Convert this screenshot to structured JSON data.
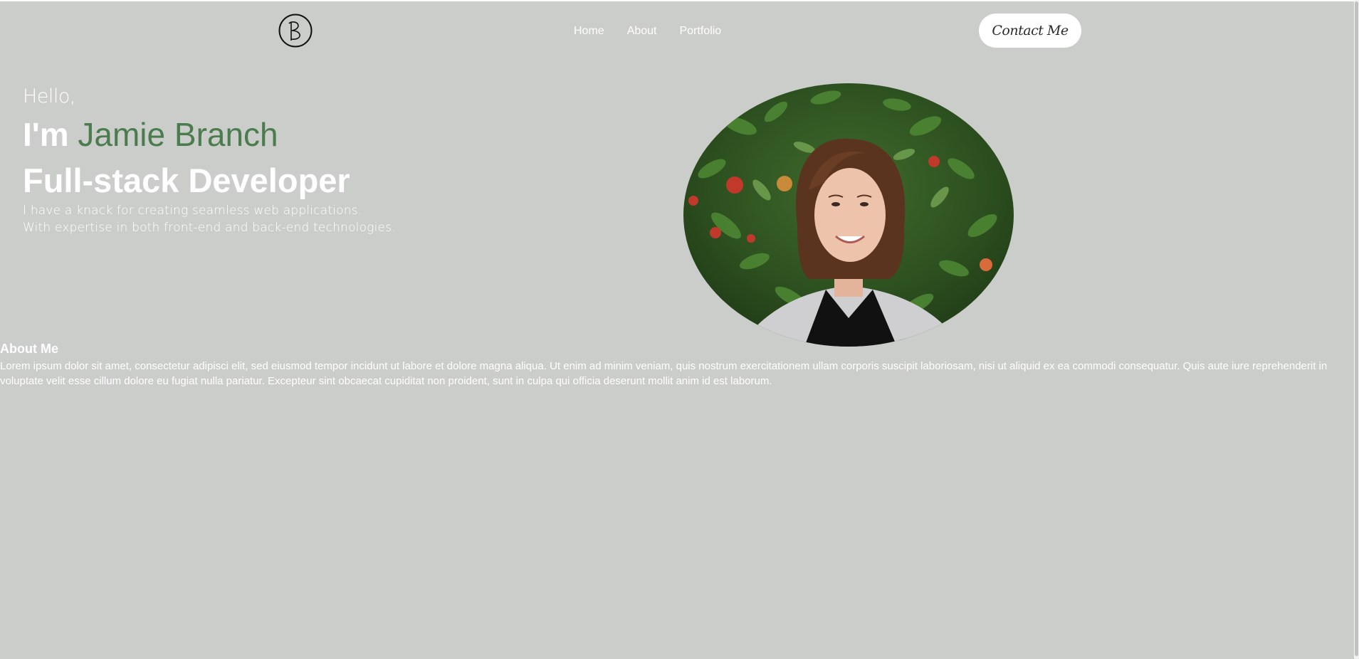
{
  "header": {
    "logo_icon": "b-monogram-logo",
    "nav": [
      {
        "label": "Home"
      },
      {
        "label": "About"
      },
      {
        "label": "Portfolio"
      }
    ],
    "contact_label": "Contact Me"
  },
  "hero": {
    "greeting": "Hello,",
    "intro_prefix": "I'm",
    "name": "Jamie Branch",
    "role": "Full-stack Developer",
    "desc_line1": "I have a knack for creating seamless web applications.",
    "desc_line2": "With expertise in both front-end and back-end technologies.",
    "portrait_alt": "portrait-photo"
  },
  "about": {
    "title": "About Me",
    "text": "Lorem ipsum dolor sit amet, consectetur adipisci elit, sed eiusmod tempor incidunt ut labore et dolore magna aliqua. Ut enim ad minim veniam, quis nostrum exercitationem ullam corporis suscipit laboriosam, nisi ut aliquid ex ea commodi consequatur. Quis aute iure reprehenderit in voluptate velit esse cillum dolore eu fugiat nulla pariatur. Excepteur sint obcaecat cupiditat non proident, sunt in culpa qui officia deserunt mollit anim id est laborum."
  },
  "colors": {
    "background": "#cbcdca",
    "accent": "#4a7c4e",
    "text": "#ffffff",
    "button_bg": "#ffffff"
  }
}
